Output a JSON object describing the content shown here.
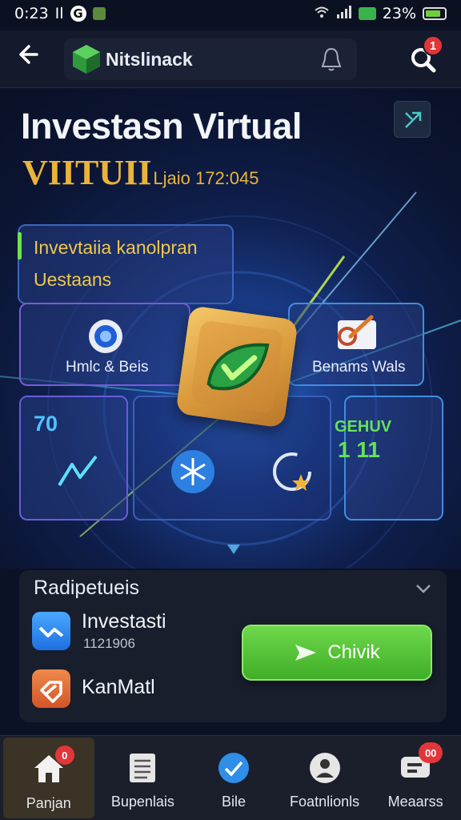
{
  "status_bar": {
    "time": "0:23",
    "left_glyphs": "Il",
    "g_letter": "G",
    "right_text": "23%"
  },
  "header": {
    "brand": "Nitslinack",
    "search_badge": "1"
  },
  "hero": {
    "title": "Investasn Virtual",
    "subtitle_big": "VIITUII",
    "subtitle_small": "Ljaio 172:045",
    "card_top_line1": "Invevtaiia kanolpran",
    "card_top_line2": "Uestaans",
    "card_left_label": "Hmlc & Beis",
    "card_right_label": "Benams Wals",
    "stat_left_value": "70",
    "stat_right_label": "GEHUV",
    "stat_right_value": "1 11"
  },
  "section": {
    "title": "Radipetueis",
    "items": [
      {
        "label": "Investasti",
        "sub": "1121906",
        "icon": "chart-icon"
      },
      {
        "label": "KanMatl",
        "icon": "tag-icon"
      }
    ],
    "cta_label": "Chivik"
  },
  "bottom_nav": [
    {
      "label": "Panjan",
      "icon": "home-icon",
      "badge": "0",
      "active": true
    },
    {
      "label": "Bupenlais",
      "icon": "list-icon"
    },
    {
      "label": "Bile",
      "icon": "check-circle-icon"
    },
    {
      "label": "Foatnlionls",
      "icon": "person-icon"
    },
    {
      "label": "Meaarss",
      "icon": "message-icon",
      "badge": "00"
    }
  ],
  "colors": {
    "accent_gold": "#e9b43a",
    "cta_green": "#4cc232",
    "badge_red": "#e1363a",
    "panel_blue": "#4f72c8"
  }
}
